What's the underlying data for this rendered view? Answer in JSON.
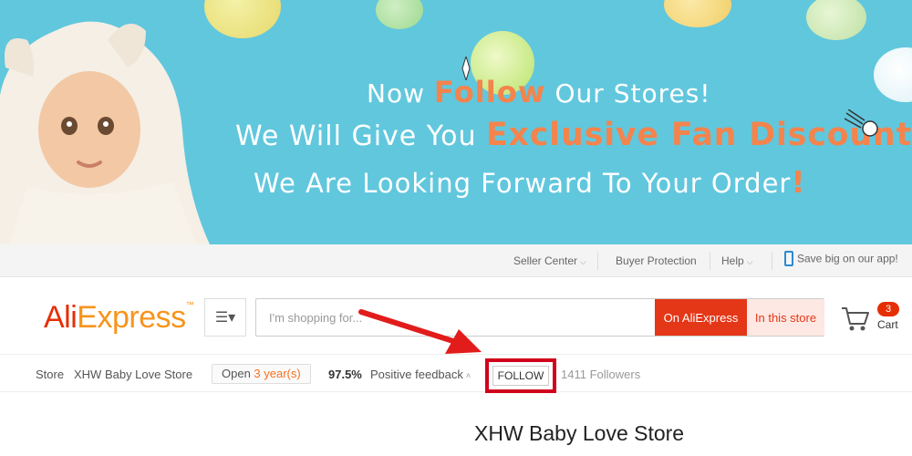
{
  "banner": {
    "line1_pre": "Now ",
    "line1_accent": "Follow",
    "line1_post": " Our Stores!",
    "line2_pre": "We Will Give You ",
    "line2_accent": "Exclusive Fan Discounts!",
    "line3_pre": "We Are Looking Forward To Your Order",
    "line3_accent": "!"
  },
  "topbar": {
    "seller_center": "Seller Center",
    "buyer_protection": "Buyer Protection",
    "help": "Help",
    "app_promo": "Save big on our app!"
  },
  "header": {
    "logo_part1": "Ali",
    "logo_part2": "Express",
    "logo_tm": "™",
    "search_placeholder": "I'm shopping for...",
    "on_aliexpress": "On AliExpress",
    "in_this_store": "In this store",
    "cart_count": "3",
    "cart_label": "Cart"
  },
  "store_bar": {
    "store_label": "Store",
    "store_name": "XHW Baby Love Store",
    "open_label": "Open ",
    "open_years": "3 year(s)",
    "feedback_percent": "97.5%",
    "feedback_label": "Positive feedback",
    "follow_label": "FOLLOW",
    "followers": "1411 Followers"
  },
  "store_title": "XHW Baby Love Store",
  "colors": {
    "banner_bg": "#61c7dd",
    "accent_orange": "#f5834c",
    "aliexpress_red": "#e43718",
    "highlight_box": "#d0021b"
  }
}
